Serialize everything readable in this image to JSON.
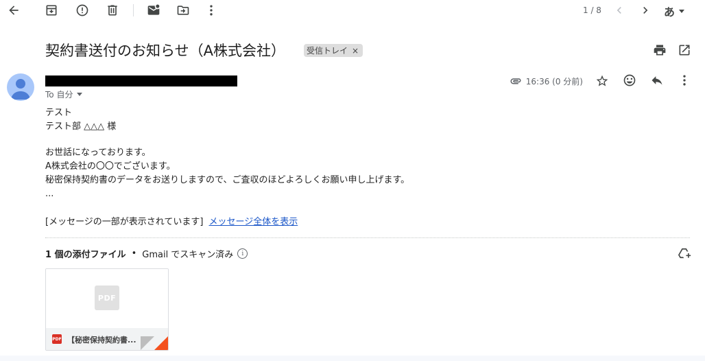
{
  "toolbar": {
    "icons": [
      "back-arrow-icon",
      "archive-icon",
      "report-spam-icon",
      "delete-icon",
      "mark-unread-icon",
      "move-to-icon",
      "more-vert-icon"
    ],
    "pager": "1 / 8",
    "ime_label": "あ"
  },
  "email": {
    "subject": "契約書送付のお知らせ（A株式会社）",
    "label": "受信トレイ",
    "label_close": "×",
    "to_line": "To 自分",
    "time": "16:36 (0 分前)",
    "body_lines_1": [
      "テスト",
      "テスト部 △△△ 様"
    ],
    "body_lines_2": [
      "お世話になっております。",
      "A株式会社の〇〇でございます。",
      "秘密保持契約書のデータをお送りしますので、ご査収のほどよろしくお願い申し上げます。",
      "..."
    ],
    "truncated_text": "[メッセージの一部が表示されています]",
    "show_full_link": "メッセージ全体を表示"
  },
  "attachments": {
    "count_label": "1 個の添付ファイル",
    "separator": "•",
    "scan_label": "Gmail でスキャン済み",
    "info_glyph": "i",
    "file": {
      "type_label": "PDF",
      "name": "【秘密保持契約書..."
    }
  },
  "colors": {
    "link": "#1a56c8",
    "pdf_red": "#d93025",
    "avatar": "#a8c7fa",
    "chip_bg": "#dddddd"
  }
}
